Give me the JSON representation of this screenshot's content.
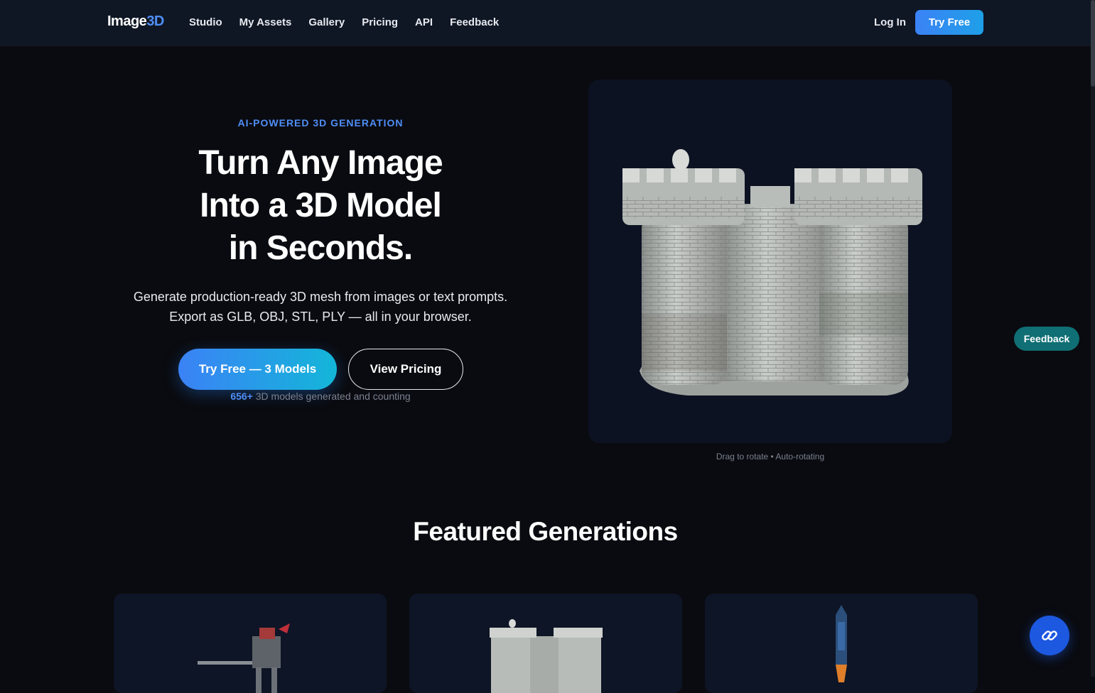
{
  "nav": {
    "logo_main": "Image",
    "logo_accent": "3D",
    "links": [
      "Studio",
      "My Assets",
      "Gallery",
      "Pricing",
      "API",
      "Feedback"
    ],
    "login": "Log In",
    "try_free": "Try Free"
  },
  "hero": {
    "eyebrow": "AI-POWERED 3D GENERATION",
    "title_line1": "Turn Any Image",
    "title_line2": "Into a 3D Model",
    "title_line3": "in Seconds.",
    "subtitle_line1": "Generate production-ready 3D mesh from images or text prompts.",
    "subtitle_line2": "Export as GLB, OBJ, STL, PLY — all in your browser.",
    "primary_cta": "Try Free — 3 Models",
    "secondary_cta": "View Pricing",
    "counter_number": "656+",
    "counter_text": "3D models generated and counting"
  },
  "viewer": {
    "caption": "Drag to rotate • Auto-rotating",
    "model": "stone castle with two towers"
  },
  "floating": {
    "feedback": "Feedback",
    "fab_icon": "link-icon"
  },
  "featured": {
    "title": "Featured Generations",
    "cards": [
      {
        "model": "mech robot"
      },
      {
        "model": "stone castle"
      },
      {
        "model": "rocket"
      }
    ]
  },
  "colors": {
    "accent": "#4f8ef7",
    "background": "#0a0b10",
    "nav": "#0f1624",
    "card": "#0e1526",
    "feedback": "#0f6f74",
    "fab": "#1c58e0"
  }
}
